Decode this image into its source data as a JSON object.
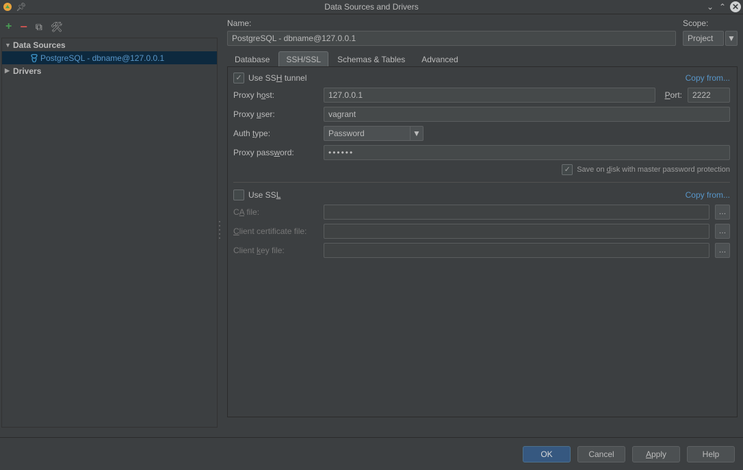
{
  "window": {
    "title": "Data Sources and Drivers"
  },
  "sidebar": {
    "sections": {
      "data_sources": "Data Sources",
      "drivers": "Drivers"
    },
    "items": [
      {
        "label": "PostgreSQL - dbname@127.0.0.1"
      }
    ]
  },
  "header": {
    "name_label": "Name:",
    "name_value": "PostgreSQL - dbname@127.0.0.1",
    "scope_label": "Scope:",
    "scope_value": "Project"
  },
  "tabs": {
    "database": "Database",
    "ssh_ssl": "SSH/SSL",
    "schemas": "Schemas & Tables",
    "advanced": "Advanced"
  },
  "ssh": {
    "use_tunnel_before": "Use SS",
    "use_tunnel_u": "H",
    "use_tunnel_after": " tunnel",
    "copy_from": "Copy from...",
    "proxy_host_label_pre": "Proxy h",
    "proxy_host_label_u": "o",
    "proxy_host_label_post": "st:",
    "proxy_host": "127.0.0.1",
    "port_label_u": "P",
    "port_label_rest": "ort:",
    "port": "2222",
    "proxy_user_label_pre": "Proxy ",
    "proxy_user_label_u": "u",
    "proxy_user_label_post": "ser:",
    "proxy_user": "vagrant",
    "auth_type_label_pre": "Auth ",
    "auth_type_label_u": "t",
    "auth_type_label_post": "ype:",
    "auth_type_value": "Password",
    "proxy_pass_label_pre": "Proxy pass",
    "proxy_pass_label_u": "w",
    "proxy_pass_label_post": "ord:",
    "proxy_pass": "••••••",
    "save_on_disk_pre": "Save on ",
    "save_on_disk_u": "d",
    "save_on_disk_post": "isk with master password protection"
  },
  "ssl": {
    "use_ssl_pre": "Use SS",
    "use_ssl_u": "L",
    "copy_from": "Copy from...",
    "ca_file_pre": "C",
    "ca_file_u": "A",
    "ca_file_post": " file:",
    "client_cert_u": "C",
    "client_cert_post": "lient certificate file:",
    "client_key_pre": "Client ",
    "client_key_u": "k",
    "client_key_post": "ey file:"
  },
  "footer": {
    "ok": "OK",
    "cancel": "Cancel",
    "apply_u": "A",
    "apply_rest": "pply",
    "help": "Help"
  }
}
